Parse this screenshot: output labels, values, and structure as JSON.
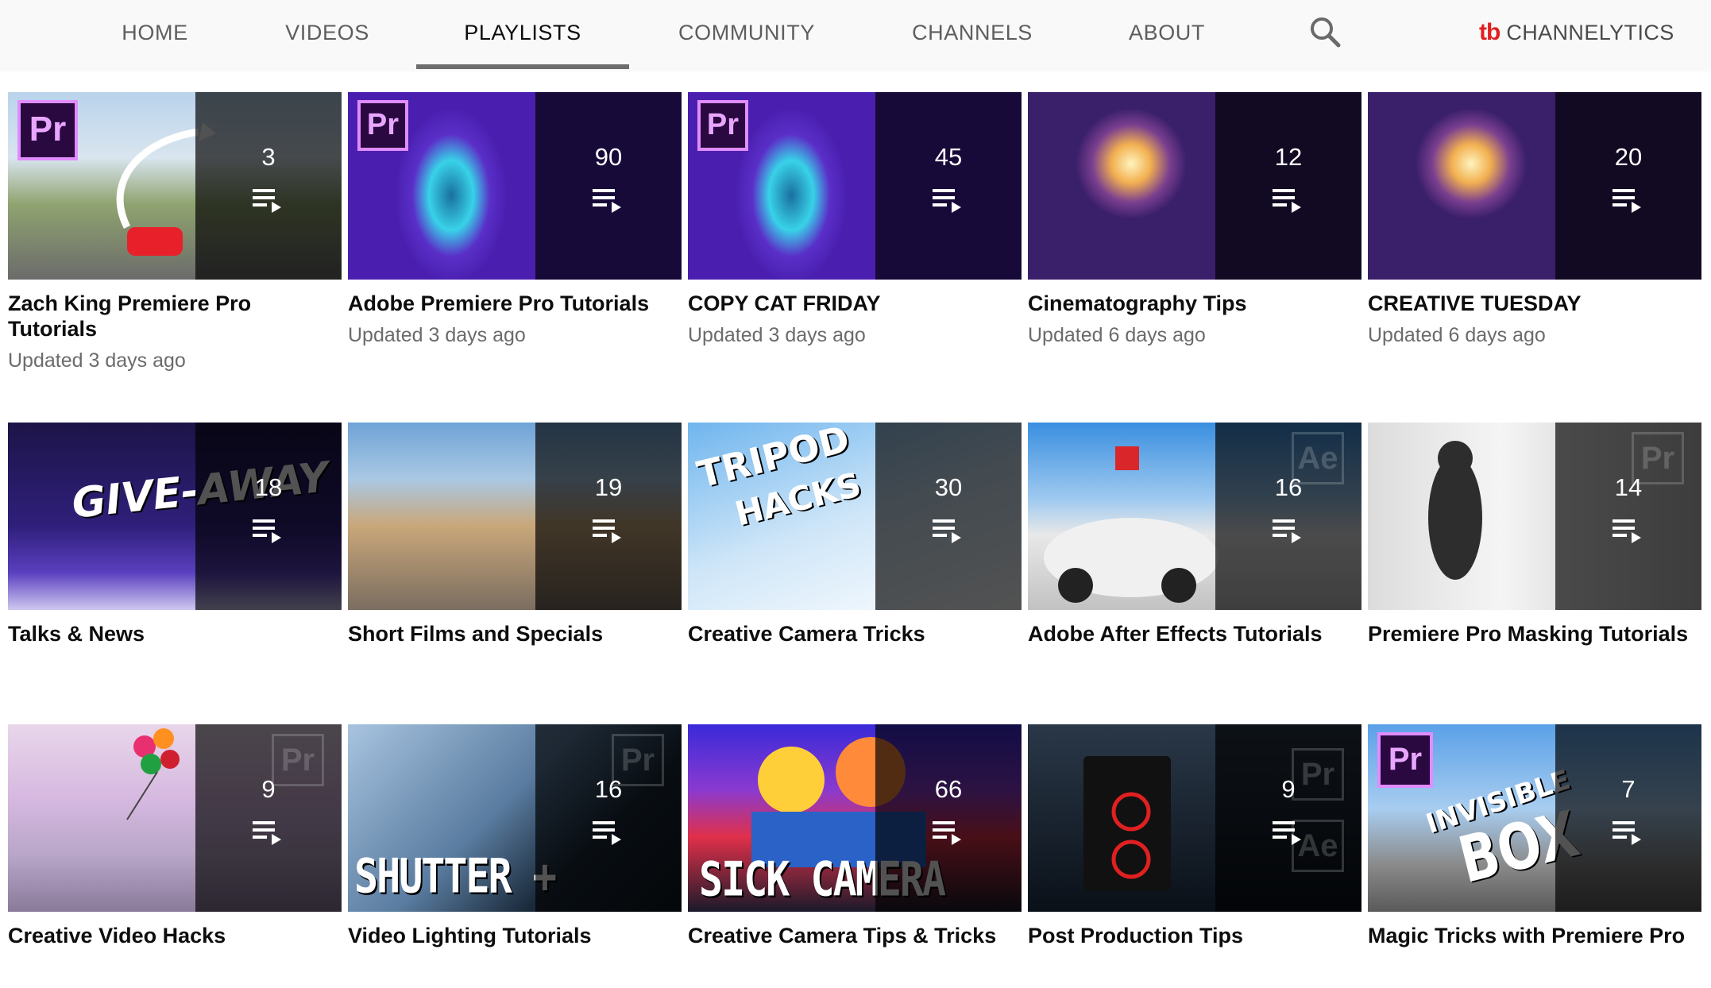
{
  "tabs": [
    {
      "label": "HOME"
    },
    {
      "label": "VIDEOS"
    },
    {
      "label": "PLAYLISTS"
    },
    {
      "label": "COMMUNITY"
    },
    {
      "label": "CHANNELS"
    },
    {
      "label": "ABOUT"
    }
  ],
  "brand": {
    "logo": "tb",
    "name": "CHANNELYTICS"
  },
  "badge_text": "Pr",
  "playlists": [
    {
      "title": "Zach King Premiere Pro Tutorials",
      "count": "3",
      "updated": "Updated 3 days ago"
    },
    {
      "title": "Adobe Premiere Pro Tutorials",
      "count": "90",
      "updated": "Updated 3 days ago"
    },
    {
      "title": "COPY CAT FRIDAY",
      "count": "45",
      "updated": "Updated 3 days ago"
    },
    {
      "title": "Cinematography Tips",
      "count": "12",
      "updated": "Updated 6 days ago"
    },
    {
      "title": "CREATIVE TUESDAY",
      "count": "20",
      "updated": "Updated 6 days ago"
    },
    {
      "title": "Talks & News",
      "count": "18"
    },
    {
      "title": "Short Films and Specials",
      "count": "19"
    },
    {
      "title": "Creative Camera Tricks",
      "count": "30"
    },
    {
      "title": "Adobe After Effects Tutorials",
      "count": "16"
    },
    {
      "title": "Premiere Pro Masking Tutorials",
      "count": "14"
    },
    {
      "title": "Creative Video Hacks",
      "count": "9"
    },
    {
      "title": "Video Lighting Tutorials",
      "count": "16"
    },
    {
      "title": "Creative Camera Tips & Tricks",
      "count": "66"
    },
    {
      "title": "Post Production Tips",
      "count": "9"
    },
    {
      "title": "Magic Tricks with Premiere Pro",
      "count": "7"
    }
  ],
  "thumb_text": {
    "giveaway": "GIVE-AWAY",
    "tripod": "TRIPOD",
    "hacks": "HACKS",
    "shutter": "SHUTTER + SPEEDRAMP",
    "sick": "SICK CAMERA TRICKS",
    "invisible": "INVISIBLE",
    "box": "BOX",
    "ae": "Ae"
  }
}
